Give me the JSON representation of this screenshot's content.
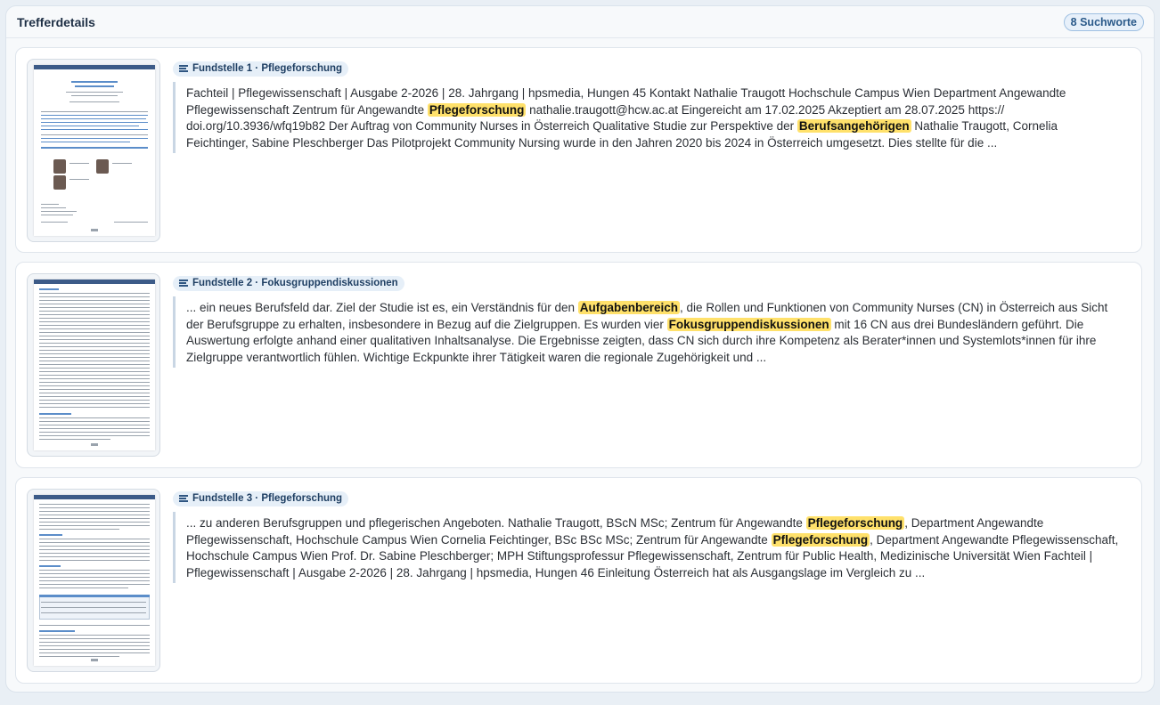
{
  "panel": {
    "title": "Trefferdetails",
    "badge": "8 Suchworte"
  },
  "hits": [
    {
      "tag": "Fundstelle 1 · Pflegeforschung",
      "segments": [
        {
          "t": "Fachteil | Pflegewissenschaft | Ausgabe 2-2026 | 28. Jahrgang | hpsmedia, Hungen 45 Kontakt Nathalie Traugott Hochschule Campus Wien Department Angewandte Pflegewissenschaft Zentrum für Angewandte ",
          "h": false
        },
        {
          "t": "Pflegeforschung",
          "h": true
        },
        {
          "t": " nathalie.traugott@hcw.ac.at Eingereicht am 17.02.2025 Akzeptiert am 28.07.2025 https:// doi.org/10.3936/wfq19b82 Der Auftrag von Community Nurses in Österreich Qualitative Studie zur Perspektive der ",
          "h": false
        },
        {
          "t": "Berufsangehörigen",
          "h": true
        },
        {
          "t": " Nathalie Traugott, Cornelia Feichtinger, Sabine Pleschberger Das Pilotprojekt Community Nursing wurde in den Jahren 2020 bis 2024 in Österreich umgesetzt. Dies stellte für die ...",
          "h": false
        }
      ]
    },
    {
      "tag": "Fundstelle 2 · Fokusgruppendiskussionen",
      "segments": [
        {
          "t": "... ein neues Berufsfeld dar. Ziel der Studie ist es, ein Verständnis für den ",
          "h": false
        },
        {
          "t": "Aufgabenbereich",
          "h": true
        },
        {
          "t": ", die Rollen und Funktionen von Community Nurses (CN) in Österreich aus Sicht der Berufsgruppe zu erhalten, insbesondere in Bezug auf die Zielgruppen. Es wurden vier ",
          "h": false
        },
        {
          "t": "Fokusgruppendiskussionen",
          "h": true
        },
        {
          "t": " mit 16 CN aus drei Bundesländern geführt. Die Auswertung erfolgte anhand einer qualitativen Inhaltsanalyse. Die Ergebnisse zeigten, dass CN sich durch ihre Kompetenz als Berater*innen und Systemlots*innen für ihre Zielgruppe verantwortlich fühlen. Wichtige Eckpunkte ihrer Tätigkeit waren die regionale Zugehörigkeit und ...",
          "h": false
        }
      ]
    },
    {
      "tag": "Fundstelle 3 · Pflegeforschung",
      "segments": [
        {
          "t": "... zu anderen Berufsgruppen und pflegerischen Angeboten. Nathalie Traugott, BScN MSc; Zentrum für Angewandte ",
          "h": false
        },
        {
          "t": "Pflegeforschung",
          "h": true
        },
        {
          "t": ", Department Angewandte Pflegewissenschaft, Hochschule Campus Wien Cornelia Feichtinger, BSc BSc MSc; Zentrum für Angewandte ",
          "h": false
        },
        {
          "t": "Pflegeforschung",
          "h": true
        },
        {
          "t": ", Department Angewandte Pflegewissenschaft, Hochschule Campus Wien Prof. Dr. Sabine Pleschberger; MPH Stiftungsprofessur Pflegewissenschaft, Zentrum für Public Health, Medizinische Universität Wien Fachteil | Pflegewissenschaft | Ausgabe 2-2026 | 28. Jahrgang | hpsmedia, Hungen 46 Einleitung Österreich hat als Ausgangslage im Vergleich zu ...",
          "h": false
        }
      ]
    }
  ]
}
